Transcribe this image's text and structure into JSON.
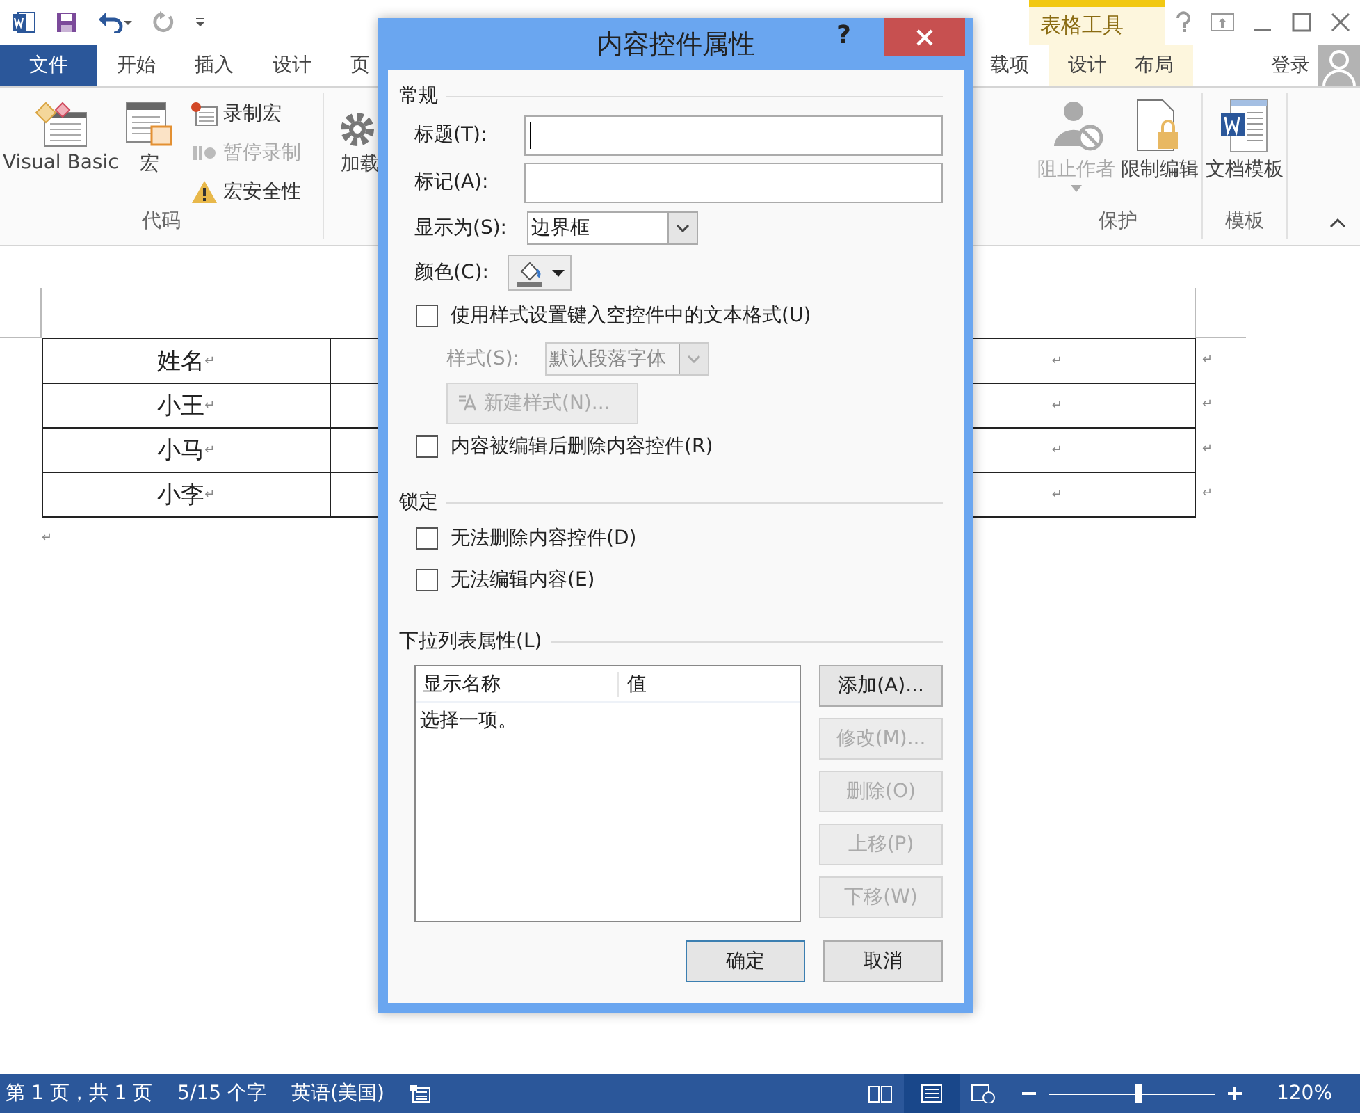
{
  "ribbon_tabs": [
    {
      "label": "文件",
      "kind": "file",
      "selected": false
    },
    {
      "label": "开始",
      "kind": "tab",
      "selected": false
    },
    {
      "label": "插入",
      "kind": "tab",
      "selected": false
    },
    {
      "label": "设计",
      "kind": "tab",
      "selected": false
    },
    {
      "label": "页",
      "kind": "tab",
      "selected": false
    },
    {
      "label": "载项",
      "kind": "tab",
      "selected": false
    }
  ],
  "context_tabs": {
    "title": "表格工具",
    "tabs": [
      {
        "label": "设计",
        "selected": false
      },
      {
        "label": "布局",
        "selected": false
      }
    ]
  },
  "sign_in": "登录",
  "ribbon_left": {
    "group": "代码",
    "large": [
      {
        "label": "Visual Basic",
        "kind": "vb"
      },
      {
        "label": "宏",
        "kind": "macro"
      }
    ],
    "small": [
      {
        "label": "录制宏",
        "kind": "record",
        "disabled": false
      },
      {
        "label": "暂停录制",
        "kind": "pause",
        "disabled": true
      },
      {
        "label": "宏安全性",
        "kind": "warning",
        "disabled": false
      }
    ],
    "next": "加载"
  },
  "ribbon_right": [
    {
      "group": "保护",
      "items": [
        {
          "label": "阻止作者",
          "kind": "block",
          "disabled": true
        },
        {
          "label": "限制编辑",
          "kind": "lock",
          "disabled": false
        }
      ]
    },
    {
      "group": "模板",
      "items": [
        {
          "label": "文档模板",
          "kind": "word",
          "disabled": false
        }
      ]
    }
  ],
  "document": {
    "rows": [
      {
        "name": "姓名",
        "name_mark": "↵",
        "cell_mark": "↵",
        "row_mark": "↵"
      },
      {
        "name": "小王",
        "name_mark": "↵",
        "cell_mark": "↵",
        "row_mark": "↵"
      },
      {
        "name": "小马",
        "name_mark": "↵",
        "cell_mark": "↵",
        "row_mark": "↵"
      },
      {
        "name": "小李",
        "name_mark": "↵",
        "cell_mark": "↵",
        "row_mark": "↵"
      }
    ],
    "paragraph_mark": "↵"
  },
  "dialog": {
    "title": "内容控件属性",
    "help": "?",
    "general": {
      "heading": "常规",
      "title_label": "标题(T):",
      "tag_label": "标记(A):",
      "show_as_label": "显示为(S):",
      "show_as_value": "边界框",
      "color_label": "颜色(C):",
      "use_style": {
        "label": "使用样式设置键入空控件中的文本格式(U)",
        "checked": false
      },
      "style_label": "样式(S):",
      "style_value": "默认段落字体",
      "style_disabled": true,
      "new_style": {
        "label": "新建样式(N)...",
        "disabled": true
      },
      "remove_after_edit": {
        "label": "内容被编辑后删除内容控件(R)",
        "checked": false
      }
    },
    "locking": {
      "heading": "锁定",
      "options": [
        {
          "label": "无法删除内容控件(D)",
          "checked": false
        },
        {
          "label": "无法编辑内容(E)",
          "checked": false
        }
      ]
    },
    "dropdown": {
      "heading": "下拉列表属性(L)",
      "columns": [
        "显示名称",
        "值"
      ],
      "rows": [
        {
          "text": "选择一项。",
          "selected": false
        }
      ],
      "buttons": [
        {
          "label": "添加(A)...",
          "disabled": false
        },
        {
          "label": "修改(M)...",
          "disabled": true
        },
        {
          "label": "删除(O)",
          "disabled": true
        },
        {
          "label": "上移(P)",
          "disabled": true
        },
        {
          "label": "下移(W)",
          "disabled": true
        }
      ]
    },
    "footer": [
      {
        "label": "确定",
        "default": true
      },
      {
        "label": "取消",
        "default": false
      }
    ]
  },
  "status_bar": {
    "page": "第 1 页，共 1 页",
    "words": "5/15 个字",
    "language": "英语(美国)",
    "zoom": {
      "level": 0.53,
      "reading": "120%"
    }
  }
}
